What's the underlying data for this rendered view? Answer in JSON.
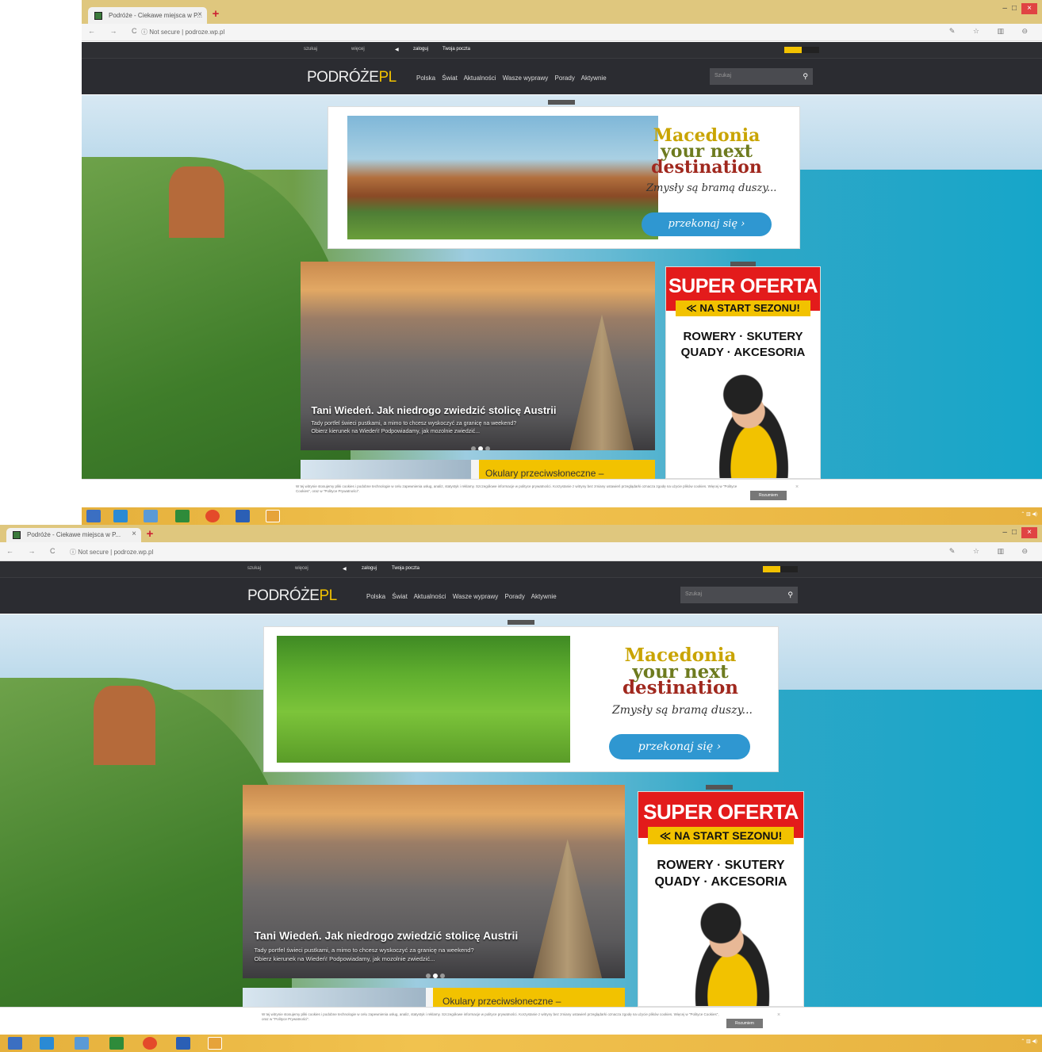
{
  "browser": {
    "tab_title": "Podróże - Ciekawe miejsca w P...",
    "tab_close": "×",
    "new_tab": "+",
    "security": "Not secure",
    "url": "podroze.wp.pl",
    "nav_glyphs": "← → C",
    "tool_glyphs": "✎ ☆ ▥ ⊖"
  },
  "topbar": {
    "left_a": "szukaj",
    "left_b": "więcej",
    "login": "zaloguj",
    "mail": "Twoja poczta"
  },
  "site": {
    "logo_main": "PODRÓŻE",
    "logo_suffix": "PL",
    "menu": [
      "Polska",
      "Świat",
      "Aktualności",
      "Wasze wyprawy",
      "Porady",
      "Aktywnie"
    ],
    "search_placeholder": "Szukaj",
    "search_icon": "search-icon"
  },
  "macedonia_ad": {
    "title_1": "Macedonia",
    "title_2": "your next",
    "title_3": "destination",
    "tagline": "Zmysły są bramą duszy...",
    "cta": "przekonaj się ›"
  },
  "hero": {
    "headline": "Tani Wiedeń. Jak niedrogo zwiedzić stolicę Austrii",
    "sub_1": "Tady portfel świeci pustkami, a mimo to chcesz wyskoczyć za granicę na weekend?",
    "sub_2": "Obierz kierunek na Wiedeń! Podpowiadamy, jak mozolnie zwiedzić..."
  },
  "strip": {
    "label": "Okulary przeciwsłoneczne –"
  },
  "side_ad": {
    "headline": "SUPER OFERTA",
    "banner": "≪ NA START SEZONU!",
    "line_1": "ROWERY · SKUTERY",
    "line_2": "QUADY · AKCESORIA"
  },
  "cookie": {
    "text_1": "W tej witrynie stosujemy pliki cookies i podobne technologie w celu zapewnienia usług, analiz, statystyk i reklamy. Szczegółowe informacje w polityce prywatności.",
    "text_2": "Korzystanie z witryny bez zmiany ustawień przeglądarki oznacza zgodę na użycie plików cookies. Więcej w \"Polityce Cookies\", oraz w \"Polityce Prywatności\".",
    "button": "Rozumiem",
    "close": "×"
  },
  "colors": {
    "tabstrip": "#dfc77e",
    "nav_bg": "#2b2c31",
    "brand_yellow": "#f2c200",
    "ad_red": "#e31b1b",
    "cta_blue": "#2f97d1",
    "taskbar": "#f1c24e"
  }
}
